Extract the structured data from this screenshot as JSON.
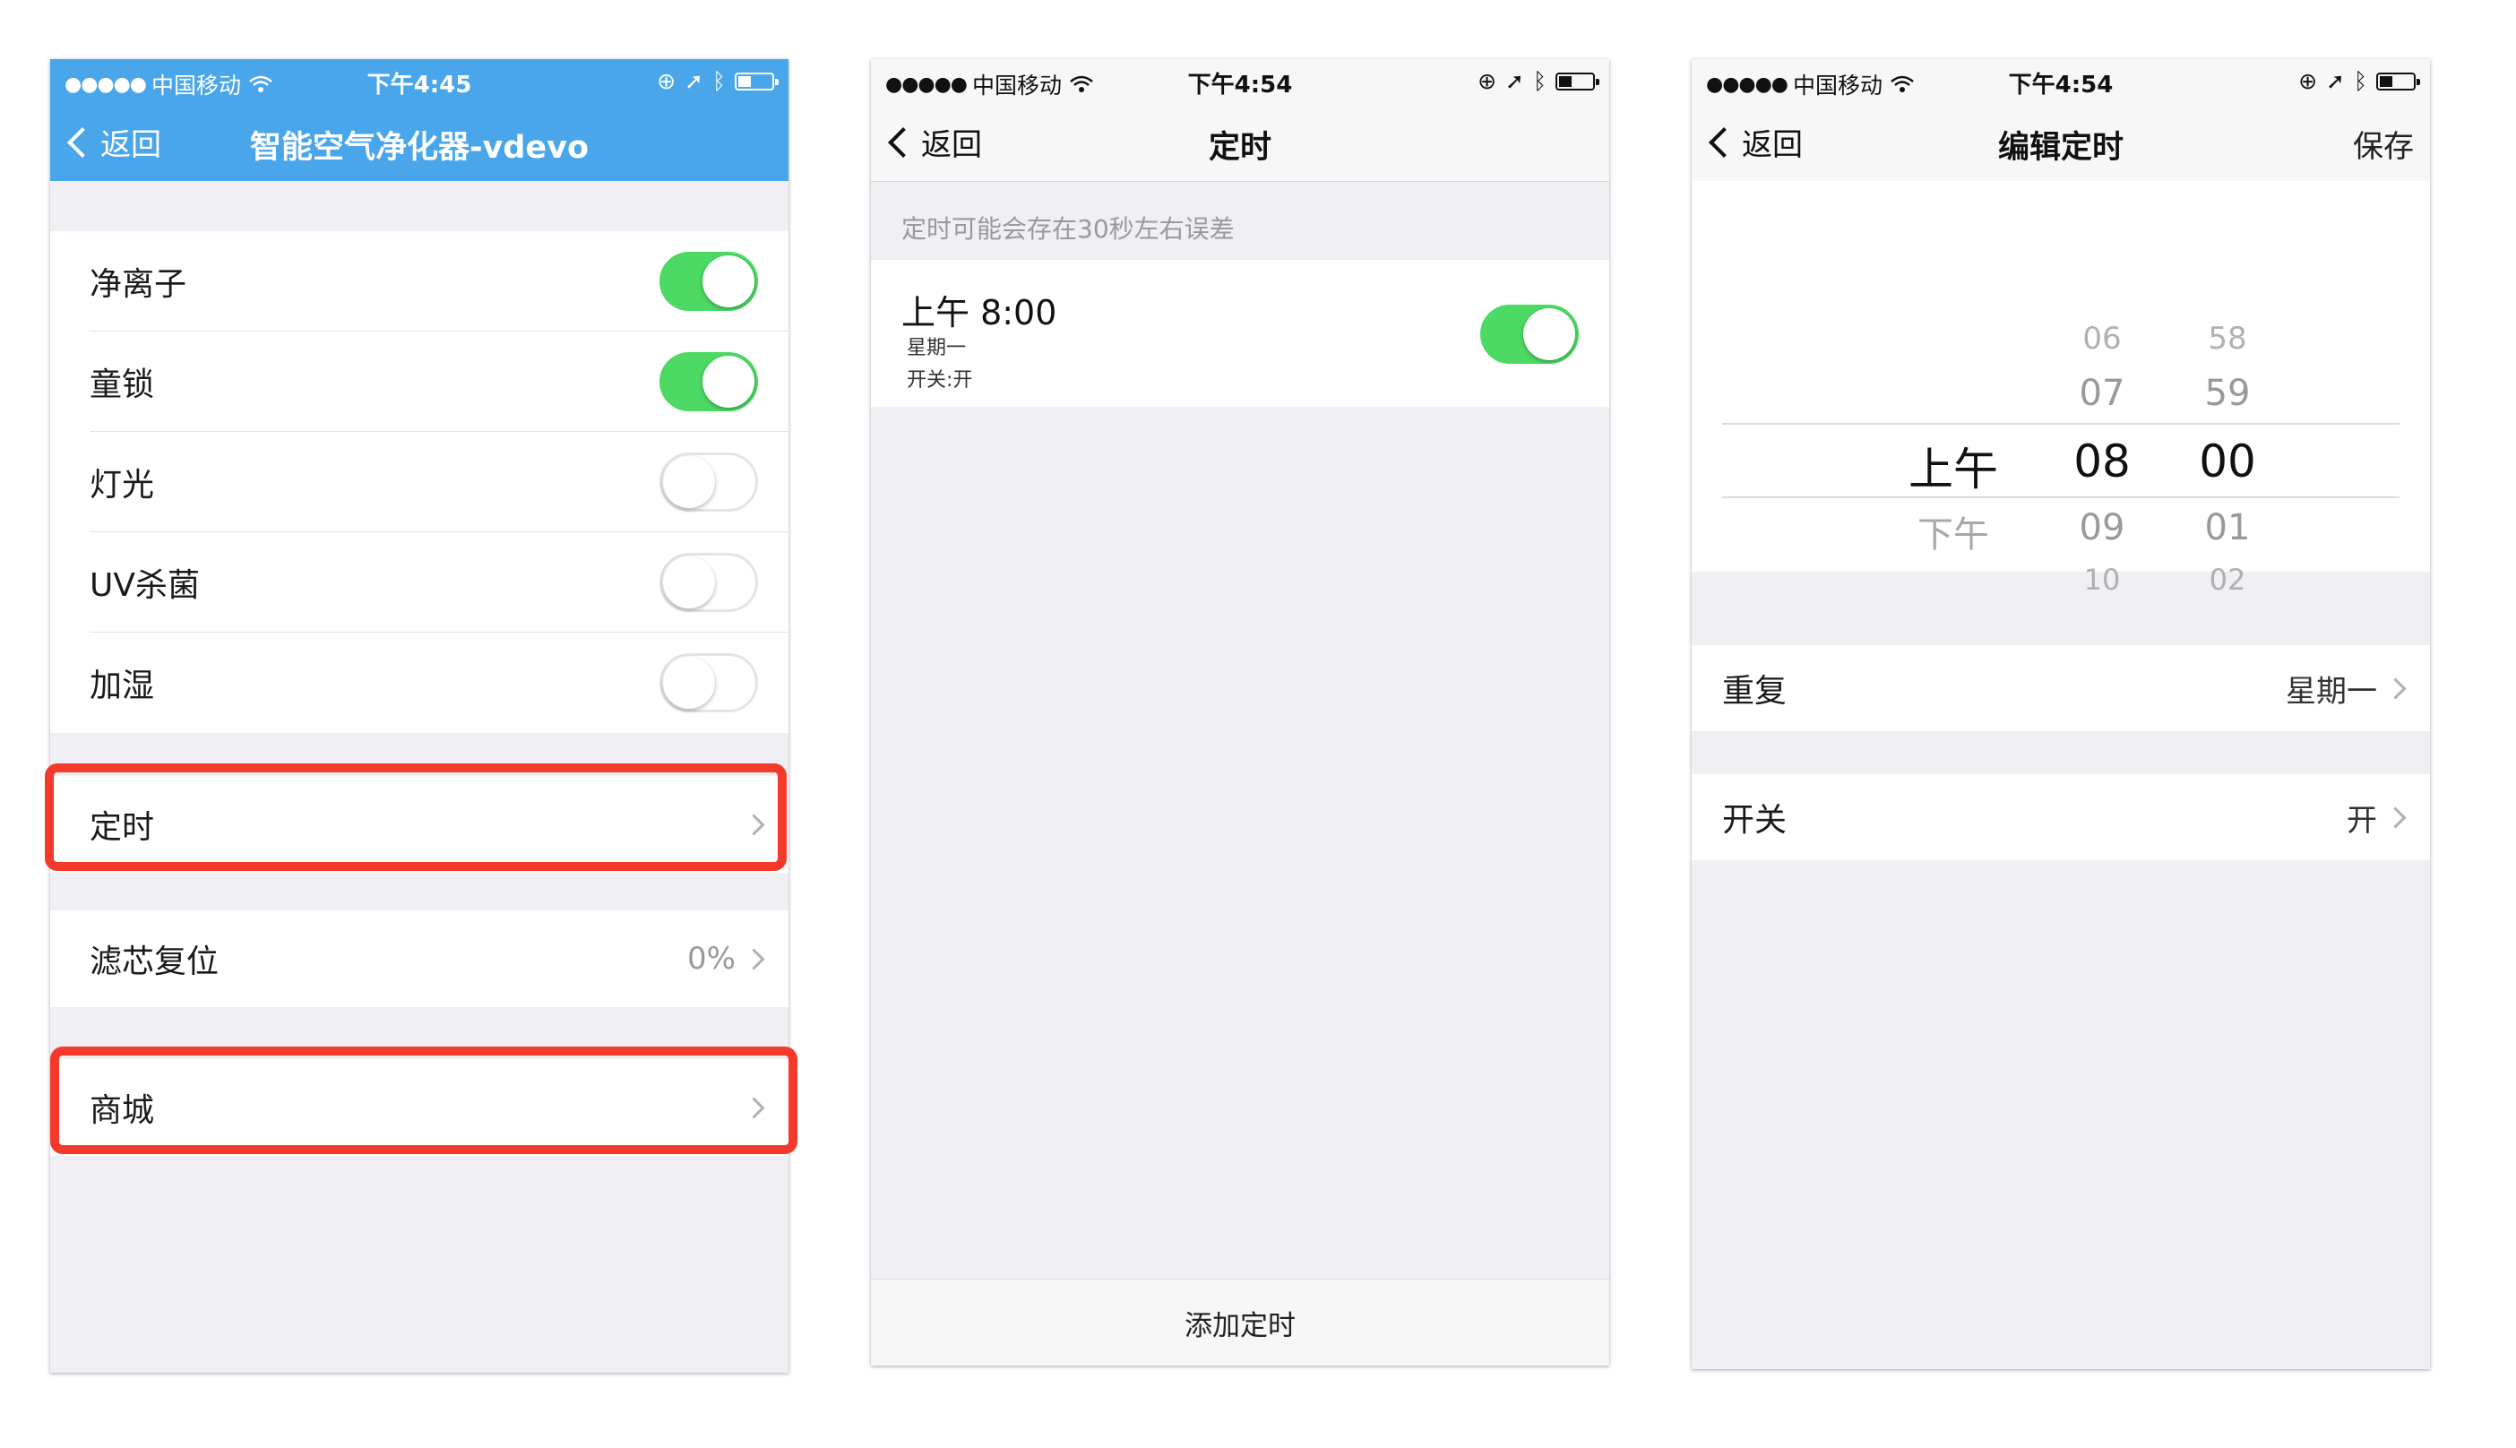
{
  "status_bar": {
    "carrier": "中国移动",
    "time_1": "下午4:45",
    "time_2": "下午4:54",
    "time_3": "下午4:54"
  },
  "screen1": {
    "back_label": "返回",
    "title": "智能空气净化器-vdevo",
    "toggles": [
      {
        "label": "净离子",
        "on": true
      },
      {
        "label": "童锁",
        "on": true
      },
      {
        "label": "灯光",
        "on": false
      },
      {
        "label": "UV杀菌",
        "on": false
      },
      {
        "label": "加湿",
        "on": false
      }
    ],
    "timer_label": "定时",
    "filter_reset_label": "滤芯复位",
    "filter_reset_value": "0%",
    "mall_label": "商城"
  },
  "screen2": {
    "back_label": "返回",
    "title": "定时",
    "notice": "定时可能会存在30秒左右误差",
    "timer_time": "上午 8:00",
    "timer_repeat": "星期一",
    "timer_switch": "开关:开",
    "timer_on": true,
    "add_timer_label": "添加定时"
  },
  "screen3": {
    "back_label": "返回",
    "title": "编辑定时",
    "save_label": "保存",
    "picker": {
      "ampm": [
        "上午",
        "下午"
      ],
      "hours_above": [
        "06",
        "07"
      ],
      "hour_selected": "08",
      "hours_below": [
        "09",
        "10"
      ],
      "minutes_above": [
        "58",
        "59"
      ],
      "minute_selected": "00",
      "minutes_below": [
        "01",
        "02"
      ]
    },
    "repeat_label": "重复",
    "repeat_value": "星期一",
    "switch_label": "开关",
    "switch_value": "开"
  },
  "colors": {
    "nav_blue": "#4aa6ea",
    "toggle_green": "#4cd964",
    "highlight_red": "#f53a2c"
  }
}
